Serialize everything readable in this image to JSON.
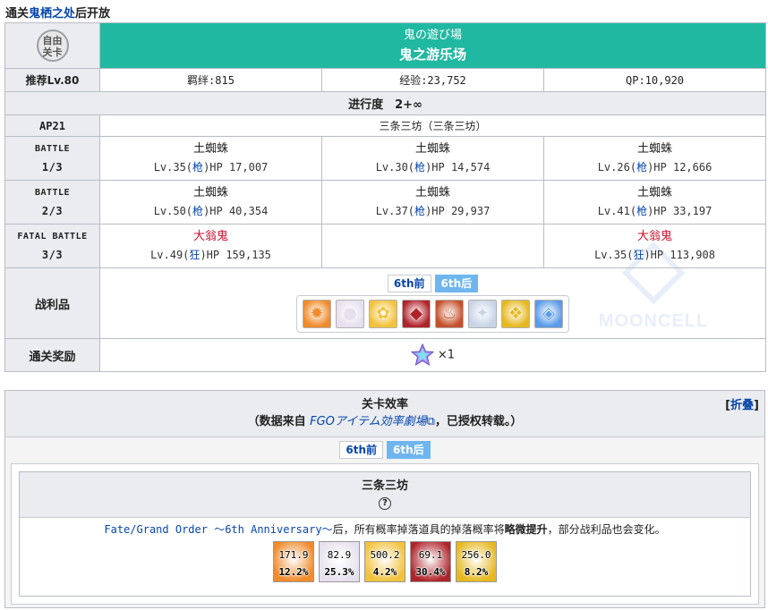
{
  "header": {
    "prefix": "通关",
    "link": "鬼栖之处",
    "suffix": "后开放"
  },
  "quest": {
    "badge_text_1": "自由",
    "badge_text_2": "关卡",
    "title_jp": "鬼の遊び場",
    "title_cn": "鬼之游乐场",
    "rec_level": "推荐Lv.80",
    "bond": "羁绊:815",
    "exp": "经验:23,752",
    "qp": "QP:10,920",
    "progress": "进行度　2+∞",
    "ap": "AP21",
    "location": "三条三坊（三条三坊）",
    "battles": [
      {
        "label_1": "BATTLE",
        "label_2": "1/3",
        "enemies": [
          {
            "name": "土蜘蛛",
            "lv": "Lv.35(",
            "cls": "枪",
            "hp": ")HP 17,007",
            "boss": false
          },
          {
            "name": "土蜘蛛",
            "lv": "Lv.30(",
            "cls": "枪",
            "hp": ")HP 14,574",
            "boss": false
          },
          {
            "name": "土蜘蛛",
            "lv": "Lv.26(",
            "cls": "枪",
            "hp": ")HP 12,666",
            "boss": false
          }
        ]
      },
      {
        "label_1": "BATTLE",
        "label_2": "2/3",
        "enemies": [
          {
            "name": "土蜘蛛",
            "lv": "Lv.50(",
            "cls": "枪",
            "hp": ")HP 40,354",
            "boss": false
          },
          {
            "name": "土蜘蛛",
            "lv": "Lv.37(",
            "cls": "枪",
            "hp": ")HP 29,937",
            "boss": false
          },
          {
            "name": "土蜘蛛",
            "lv": "Lv.41(",
            "cls": "枪",
            "hp": ")HP 33,197",
            "boss": false
          }
        ]
      },
      {
        "label_1": "FATAL BATTLE",
        "label_2": "3/3",
        "enemies": [
          {
            "name": "大翁鬼",
            "lv": "Lv.49(",
            "cls": "狂",
            "hp": ")HP 159,135",
            "boss": true
          },
          {
            "name": "",
            "lv": "",
            "cls": "",
            "hp": "",
            "boss": false
          },
          {
            "name": "大翁鬼",
            "lv": "Lv.35(",
            "cls": "狂",
            "hp": ")HP 113,908",
            "boss": true
          }
        ]
      }
    ],
    "drops_label": "战利品",
    "tab_before": "6th前",
    "tab_after": "6th后",
    "drop_items": [
      {
        "icon": "fire-orb-icon",
        "bg": "#f08a2a"
      },
      {
        "icon": "pearl-icon",
        "bg": "#e6e0ee"
      },
      {
        "icon": "gold-flower-icon",
        "bg": "#f2c23a"
      },
      {
        "icon": "red-gem-icon",
        "bg": "#b0232a"
      },
      {
        "icon": "ember-icon",
        "bg": "#c4502a"
      },
      {
        "icon": "silver-shard-icon",
        "bg": "#c8d4e6"
      },
      {
        "icon": "gold-gem-icon",
        "bg": "#e6b820"
      },
      {
        "icon": "blue-crystal-icon",
        "bg": "#5a9ae8"
      }
    ],
    "reward_label": "通关奖励",
    "reward_count": "×1"
  },
  "watermark": "MOONCELL",
  "efficiency": {
    "title": "关卡效率",
    "sub_prefix": "（数据来自 ",
    "sub_link": "FGOアイテム効率劇場",
    "sub_suffix": "，已授权转载。）",
    "collapse": "折叠",
    "inner_title": "三条三坊",
    "help": "?",
    "notice_1": "Fate/Grand Order ～6th Anniversary～",
    "notice_2": "后，所有概率掉落道具的掉落概率将",
    "notice_3": "略微提升",
    "notice_4": "，部分战利品也会变化。",
    "items": [
      {
        "icon": "fire-orb-icon",
        "bg": "#f08a2a",
        "ap": "171.9",
        "rate": "12.2%"
      },
      {
        "icon": "pearl-icon",
        "bg": "#e6e0ee",
        "ap": "82.9",
        "rate": "25.3%"
      },
      {
        "icon": "gold-flower-icon",
        "bg": "#f2c23a",
        "ap": "500.2",
        "rate": "4.2%"
      },
      {
        "icon": "red-gem-icon",
        "bg": "#b0232a",
        "ap": "69.1",
        "rate": "30.4%"
      },
      {
        "icon": "gold-gem-icon",
        "bg": "#e6b820",
        "ap": "256.0",
        "rate": "8.2%"
      }
    ]
  }
}
